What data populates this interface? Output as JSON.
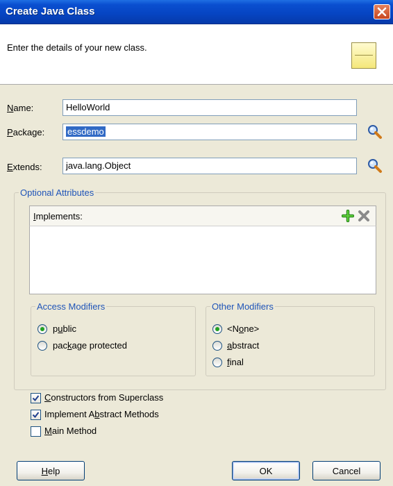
{
  "window": {
    "title": "Create Java Class"
  },
  "header": {
    "description": "Enter the details of your new class."
  },
  "form": {
    "name": {
      "label_pre": "",
      "label_u": "N",
      "label_post": "ame:",
      "value": "HelloWorld"
    },
    "package": {
      "label_u": "P",
      "label_post": "ackage:",
      "value": "essdemo"
    },
    "extends": {
      "label_u": "E",
      "label_post": "xtends:",
      "value": "java.lang.Object"
    }
  },
  "optional": {
    "legend": "Optional Attributes",
    "implements": {
      "label_u": "I",
      "label_post": "mplements:"
    },
    "access": {
      "legend": "Access Modifiers",
      "options": [
        {
          "pre": "p",
          "u": "u",
          "post": "blic",
          "selected": true
        },
        {
          "pre": "pac",
          "u": "k",
          "post": "age protected",
          "selected": false
        }
      ]
    },
    "other": {
      "legend": "Other Modifiers",
      "options": [
        {
          "pre": "<N",
          "u": "o",
          "post": "ne>",
          "selected": true
        },
        {
          "pre": "",
          "u": "a",
          "post": "bstract",
          "selected": false
        },
        {
          "pre": "",
          "u": "f",
          "post": "inal",
          "selected": false
        }
      ]
    }
  },
  "checks": [
    {
      "pre": "",
      "u": "C",
      "post": "onstructors from Superclass",
      "checked": true
    },
    {
      "pre": "Implement A",
      "u": "b",
      "post": "stract Methods",
      "checked": true
    },
    {
      "pre": "",
      "u": "M",
      "post": "ain Method",
      "checked": false
    }
  ],
  "buttons": {
    "help": {
      "pre": "",
      "u": "H",
      "post": "elp"
    },
    "ok": "OK",
    "cancel": "Cancel"
  },
  "colors": {
    "title_bar": "#0a4fd0",
    "legend_text": "#1f54b8",
    "selection": "#316ac5"
  }
}
